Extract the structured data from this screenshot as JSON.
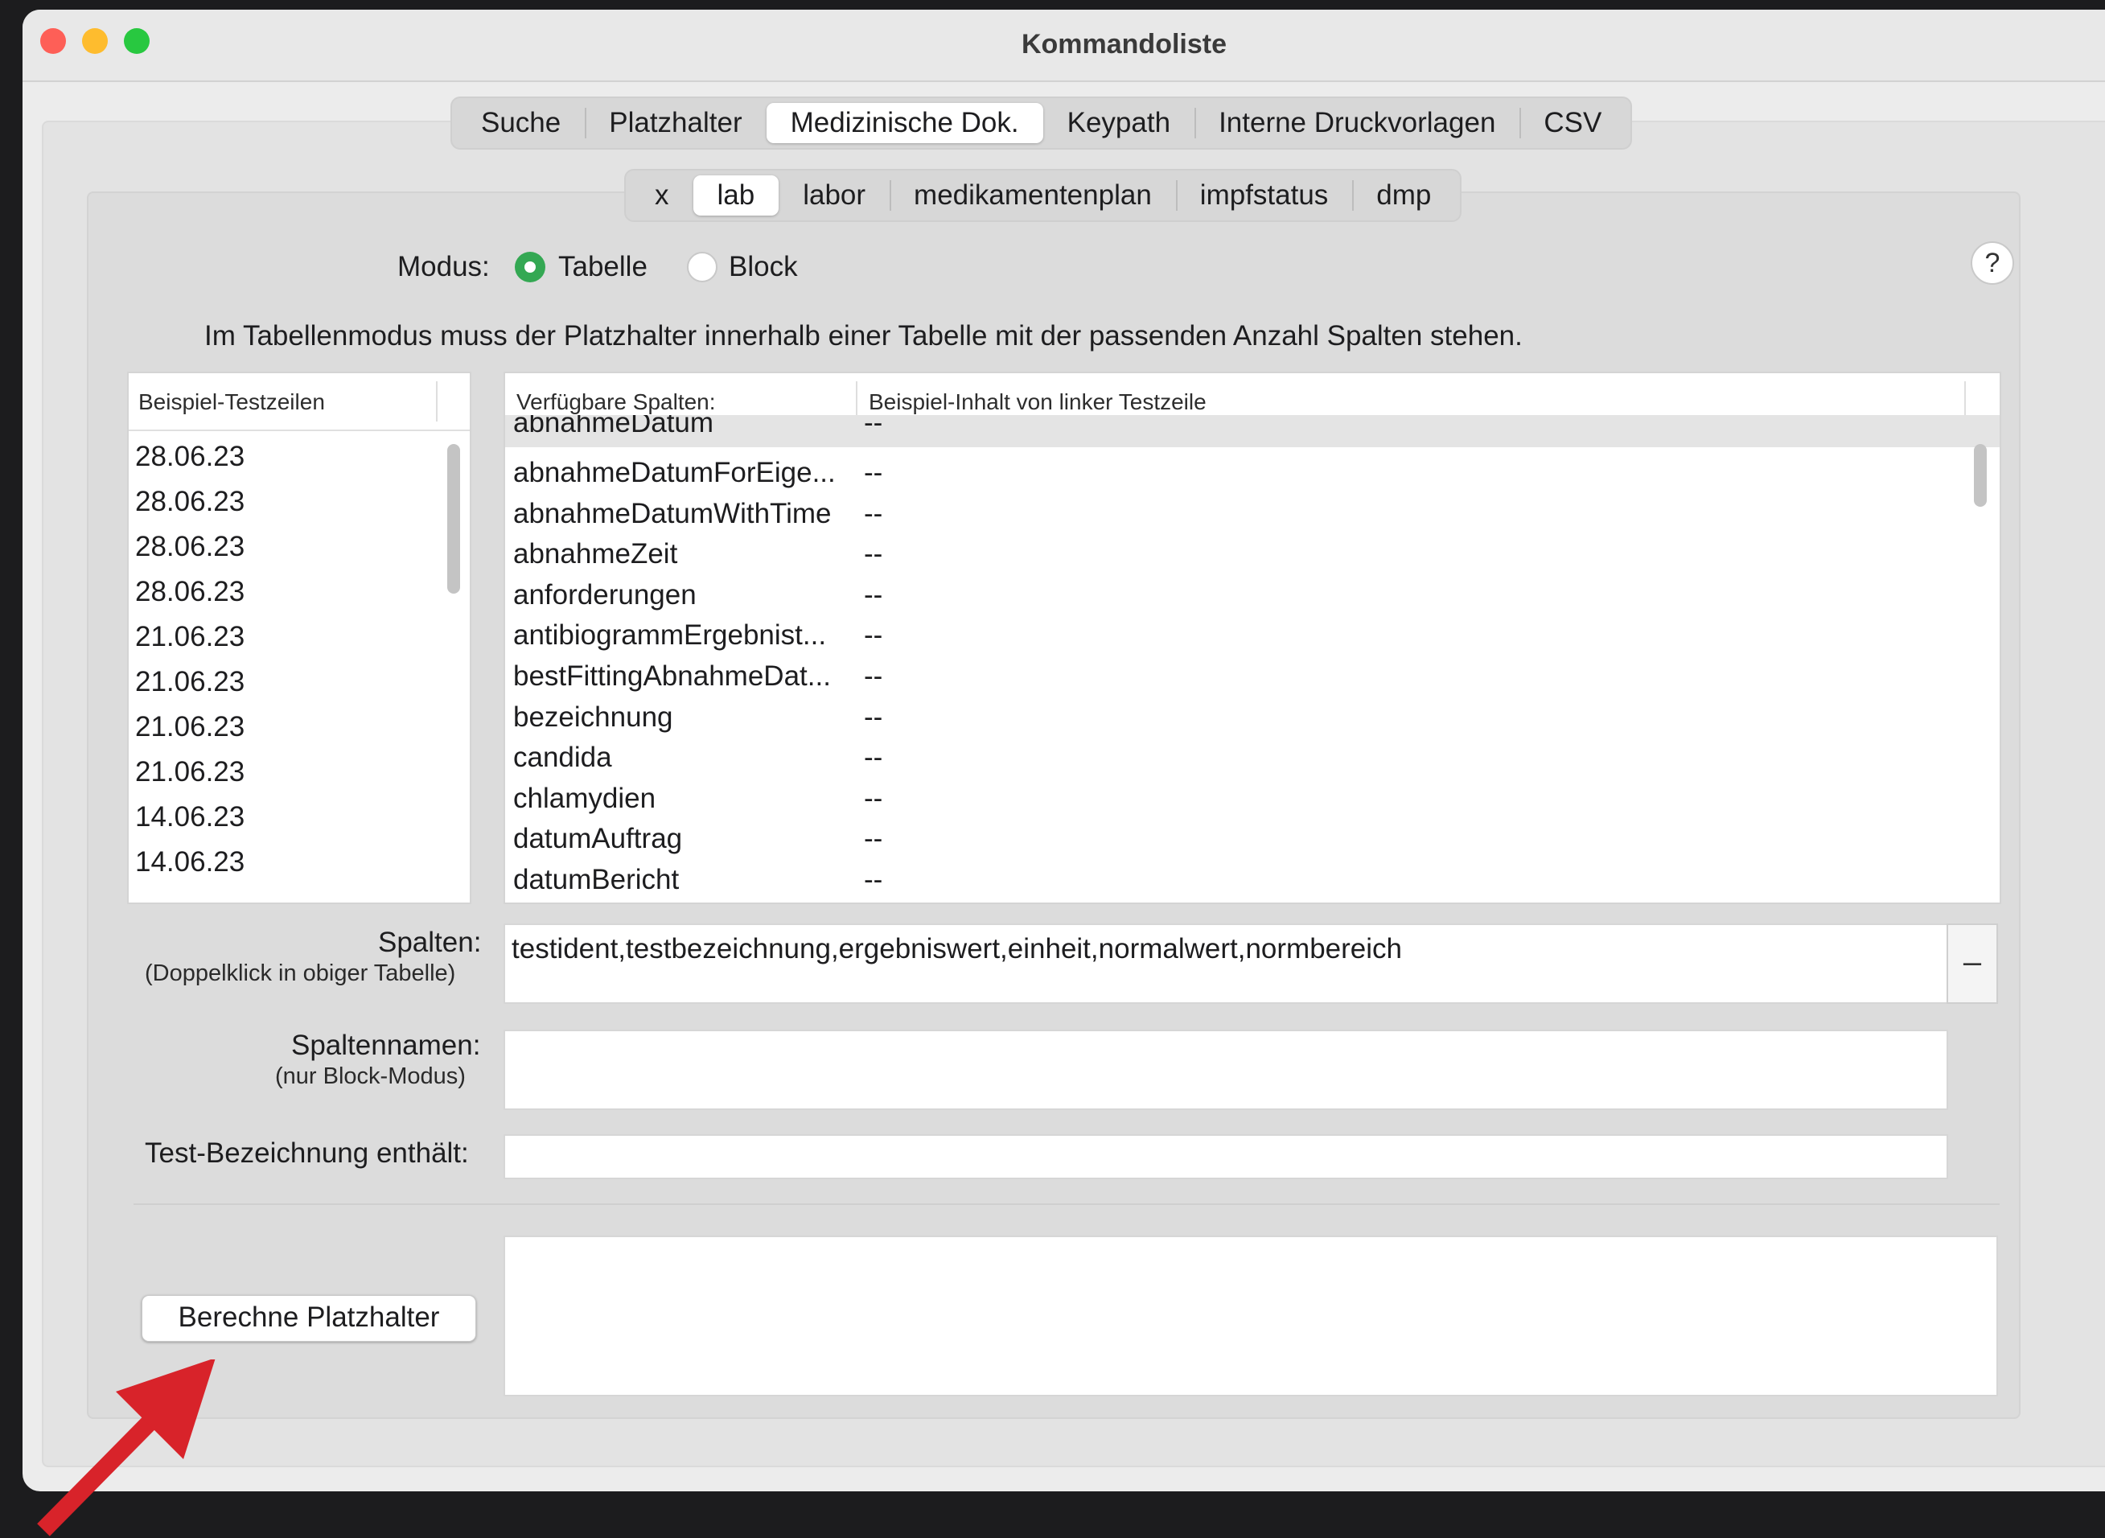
{
  "window": {
    "title": "Kommandoliste"
  },
  "main_tabs": [
    "Suche",
    "Platzhalter",
    "Medizinische Dok.",
    "Keypath",
    "Interne Druckvorlagen",
    "CSV"
  ],
  "main_tab_selected": "Medizinische Dok.",
  "sub_tabs": [
    "x",
    "lab",
    "labor",
    "medikamentenplan",
    "impfstatus",
    "dmp"
  ],
  "sub_tab_selected": "lab",
  "mode": {
    "label": "Modus:",
    "option_table": "Tabelle",
    "option_block": "Block",
    "selected": "Tabelle"
  },
  "help_label": "?",
  "info_text": "Im Tabellenmodus muss der Platzhalter innerhalb einer Tabelle mit der passenden Anzahl Spalten stehen.",
  "left_table": {
    "header": "Beispiel-Testzeilen",
    "rows": [
      "28.06.23",
      "28.06.23",
      "28.06.23",
      "28.06.23",
      "21.06.23",
      "21.06.23",
      "21.06.23",
      "21.06.23",
      "14.06.23",
      "14.06.23"
    ]
  },
  "right_table": {
    "header_col1": "Verfügbare Spalten:",
    "header_col2": "Beispiel-Inhalt von linker Testzeile",
    "partial_row": {
      "name": "abnahmeDatum",
      "value": "--"
    },
    "rows": [
      {
        "name": "abnahmeDatumForEige...",
        "value": "--"
      },
      {
        "name": "abnahmeDatumWithTime",
        "value": "--"
      },
      {
        "name": "abnahmeZeit",
        "value": "--"
      },
      {
        "name": "anforderungen",
        "value": "--"
      },
      {
        "name": "antibiogrammErgebnist...",
        "value": "--"
      },
      {
        "name": "bestFittingAbnahmeDat...",
        "value": "--"
      },
      {
        "name": "bezeichnung",
        "value": "--"
      },
      {
        "name": "candida",
        "value": "--"
      },
      {
        "name": "chlamydien",
        "value": "--"
      },
      {
        "name": "datumAuftrag",
        "value": "--"
      },
      {
        "name": "datumBericht",
        "value": "--"
      }
    ]
  },
  "columns_field": {
    "label": "Spalten:",
    "sublabel": "(Doppelklick in obiger Tabelle)",
    "value": "testident,testbezeichnung,ergebniswert,einheit,normalwert,normbereich",
    "minus_label": "–"
  },
  "column_names_field": {
    "label": "Spaltennamen:",
    "sublabel": "(nur Block-Modus)",
    "value": ""
  },
  "test_name_field": {
    "label": "Test-Bezeichnung enthält:",
    "value": ""
  },
  "compute_button": {
    "label": "Berechne Platzhalter"
  },
  "annotation_color": "#d8232a"
}
